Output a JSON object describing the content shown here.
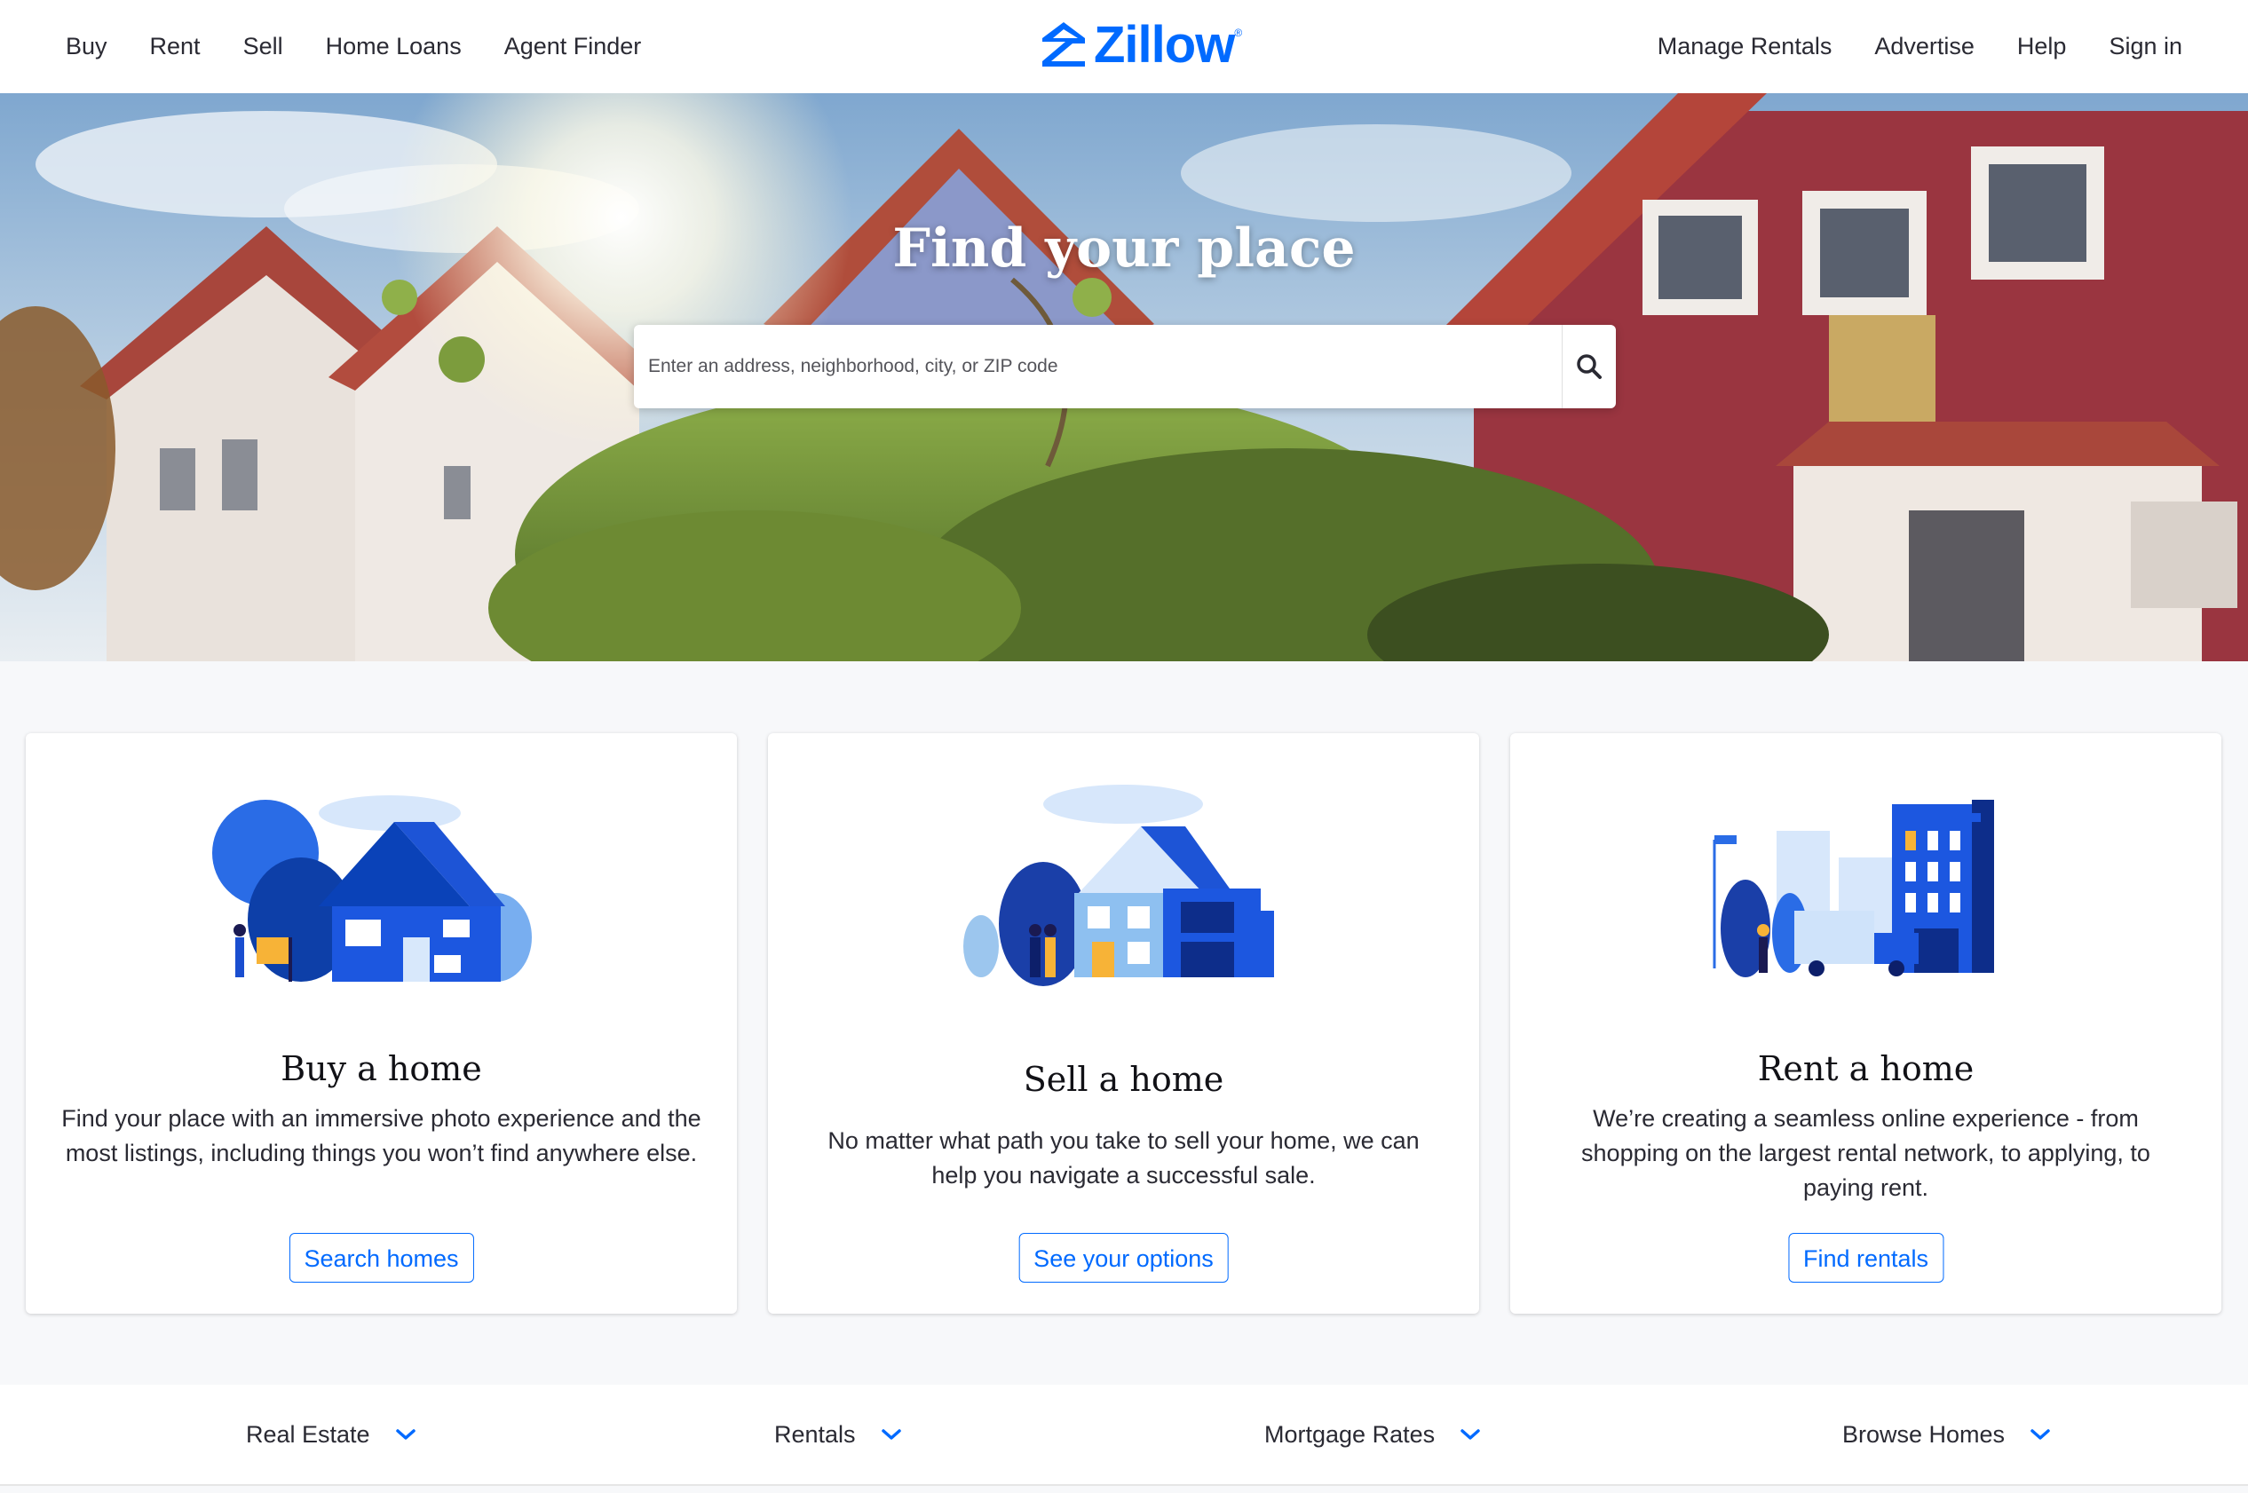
{
  "header": {
    "nav_left": [
      "Buy",
      "Rent",
      "Sell",
      "Home Loans",
      "Agent Finder"
    ],
    "nav_right": [
      "Manage Rentals",
      "Advertise",
      "Help",
      "Sign in"
    ],
    "logo_text": "Zillow"
  },
  "hero": {
    "title": "Find your place",
    "search_placeholder": "Enter an address, neighborhood, city, or ZIP code",
    "search_icon": "search-icon"
  },
  "cards": [
    {
      "title": "Buy a home",
      "description": "Find your place with an immersive photo experience and the most listings, including things you won’t find anywhere else.",
      "button": "Search homes",
      "illustration": "buy-home-illustration"
    },
    {
      "title": "Sell a home",
      "description": "No matter what path you take to sell your home, we can help you navigate a successful sale.",
      "button": "See your options",
      "illustration": "sell-home-illustration"
    },
    {
      "title": "Rent a home",
      "description": "We’re creating a seamless online experience - from shopping on the largest rental network, to applying, to paying rent.",
      "button": "Find rentals",
      "illustration": "rent-home-illustration"
    }
  ],
  "footer_links": [
    "Real Estate",
    "Rentals",
    "Mortgage Rates",
    "Browse Homes"
  ],
  "colors": {
    "brand_blue": "#006aff",
    "text": "#2a2a33",
    "page_bg": "#f7f8fa"
  }
}
